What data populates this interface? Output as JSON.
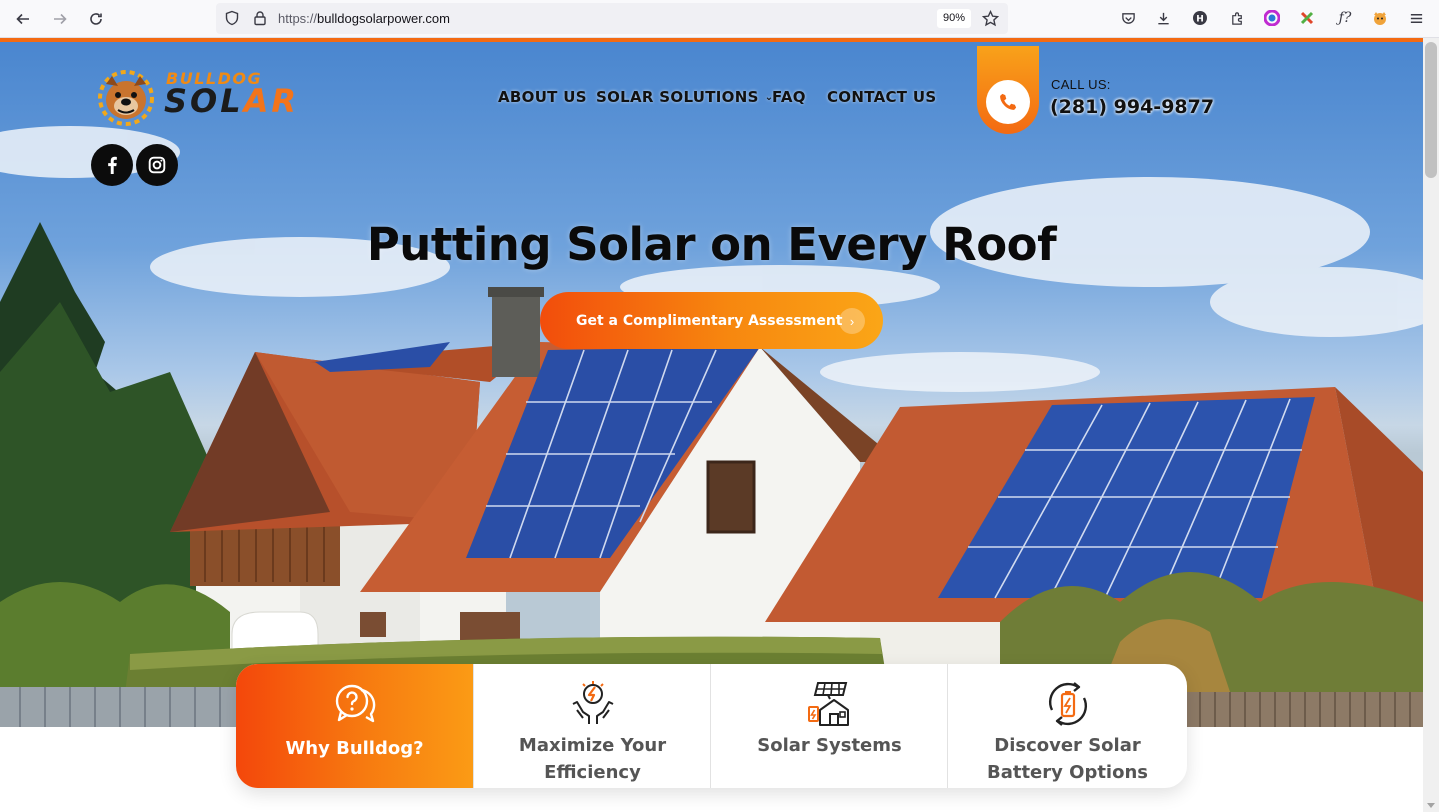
{
  "browser": {
    "url_protocol": "https://",
    "url_host": "bulldogsolarpower.com",
    "zoom": "90%"
  },
  "logo": {
    "line1": "BULLDOG",
    "line2_a": "SOL",
    "line2_b": "AR"
  },
  "social": [
    "facebook-icon",
    "instagram-icon"
  ],
  "nav": {
    "about": "ABOUT US",
    "solutions": "SOLAR SOLUTIONS",
    "faq": "FAQ",
    "contact": "CONTACT US"
  },
  "call": {
    "label": "CALL US:",
    "number": "(281) 994-9877"
  },
  "hero": {
    "title": "Putting Solar on Every Roof",
    "cta_label": "Get a Complimentary Assessment"
  },
  "features": [
    {
      "label_1": "Why Bulldog?",
      "label_2": "",
      "icon": "question-bubble-icon",
      "active": true
    },
    {
      "label_1": "Maximize Your",
      "label_2": "Efficiency",
      "icon": "energy-hands-icon",
      "active": false
    },
    {
      "label_1": "Solar Systems",
      "label_2": "",
      "icon": "solar-house-icon",
      "active": false
    },
    {
      "label_1": "Discover Solar",
      "label_2": "Battery Options",
      "icon": "battery-cycle-icon",
      "active": false
    }
  ],
  "colors": {
    "brand_orange": "#f36a12",
    "brand_yellow": "#fba617",
    "text_dark": "#111111"
  }
}
